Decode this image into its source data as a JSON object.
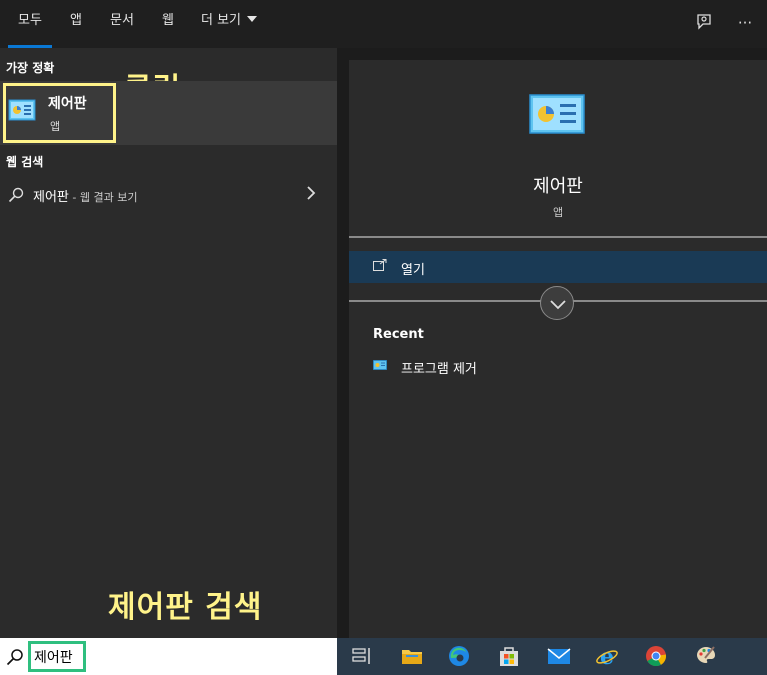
{
  "tabs": [
    {
      "label": "모두"
    },
    {
      "label": "앱"
    },
    {
      "label": "문서"
    },
    {
      "label": "웹"
    },
    {
      "label": "더 보기"
    }
  ],
  "top_icons": {
    "feedback": "feedback-icon",
    "more": "···"
  },
  "left": {
    "best_match_title": "가장 정확",
    "best_match": {
      "name": "제어판",
      "type": "앱"
    },
    "annotation_click": "클릭",
    "web_search_title": "웹 검색",
    "web_result": {
      "query": "제어판",
      "suffix": " - 웹 결과 보기"
    },
    "annotation_search": "제어판 검색"
  },
  "detail": {
    "name": "제어판",
    "type": "앱",
    "open_label": "열기",
    "recent_title": "Recent",
    "recent_items": [
      {
        "label": "프로그램 제거"
      }
    ]
  },
  "search": {
    "value": "제어판"
  },
  "colors": {
    "accent": "#0a78d4",
    "annotation": "#fff38a",
    "search_highlight": "#2fbf7f"
  }
}
